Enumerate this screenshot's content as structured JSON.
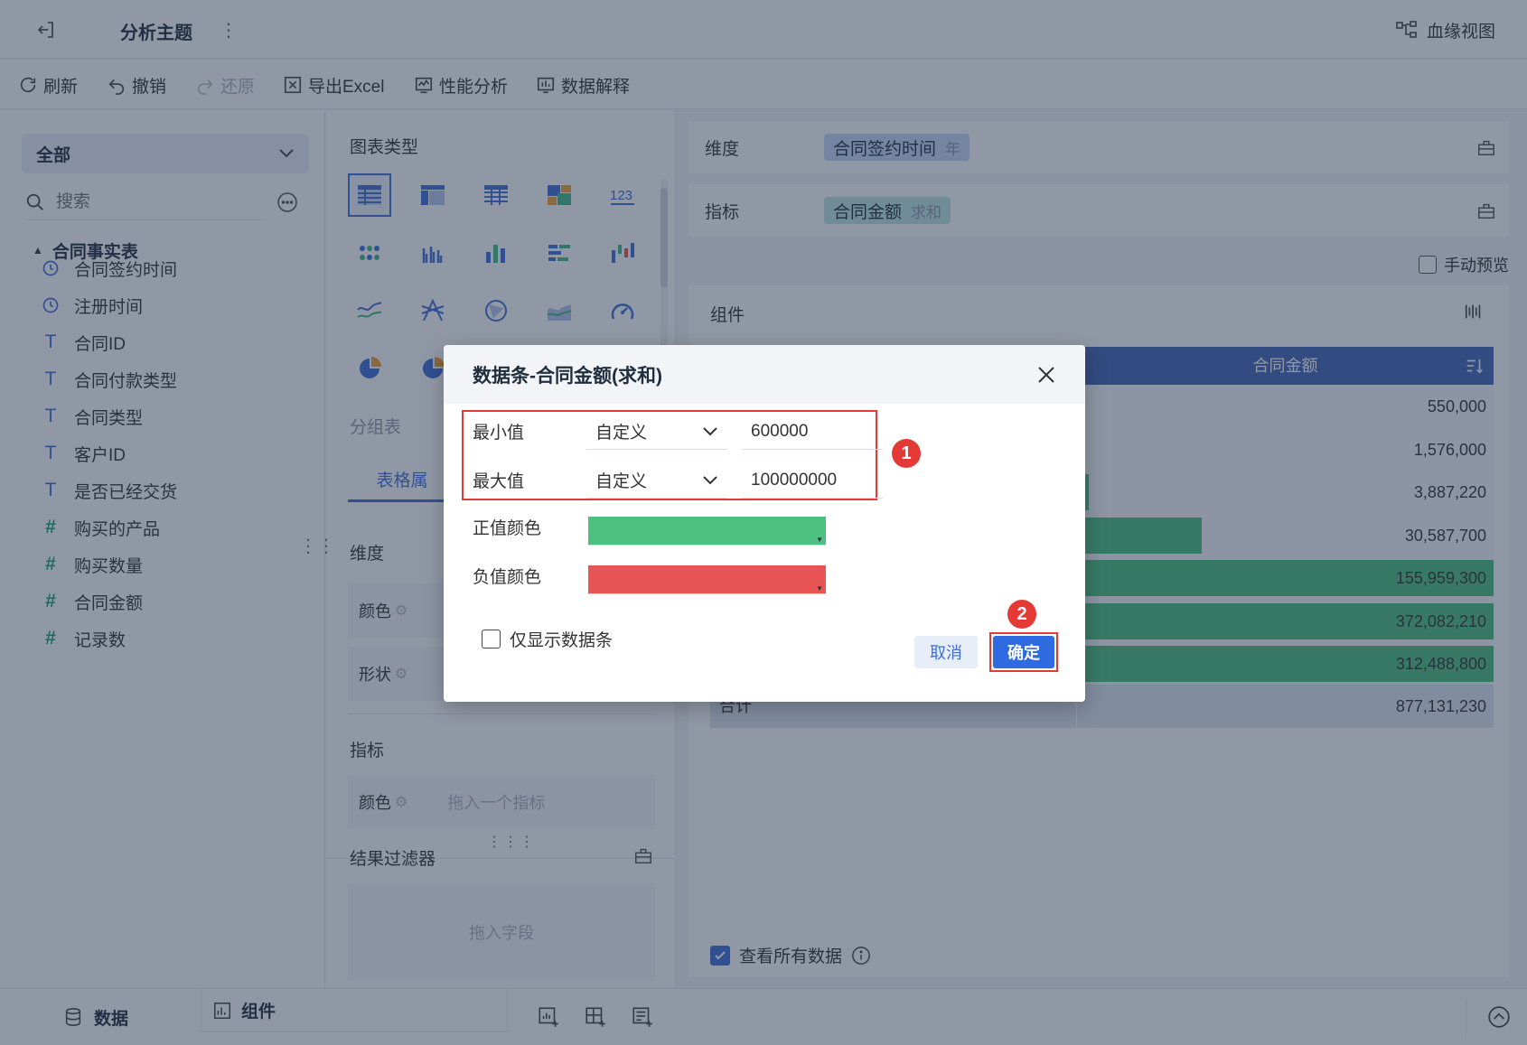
{
  "header": {
    "title": "分析主题",
    "lineage_label": "血缘视图"
  },
  "toolbar": {
    "refresh": "刷新",
    "undo": "撤销",
    "redo": "还原",
    "export": "导出Excel",
    "performance": "性能分析",
    "explain": "数据解释"
  },
  "left": {
    "scope_selected": "全部",
    "search_placeholder": "搜索",
    "table_name": "合同事实表",
    "fields": [
      {
        "name": "合同签约时间",
        "type": "date"
      },
      {
        "name": "注册时间",
        "type": "date"
      },
      {
        "name": "合同ID",
        "type": "text"
      },
      {
        "name": "合同付款类型",
        "type": "text"
      },
      {
        "name": "合同类型",
        "type": "text"
      },
      {
        "name": "客户ID",
        "type": "text"
      },
      {
        "name": "是否已经交货",
        "type": "text"
      },
      {
        "name": "购买的产品",
        "type": "number"
      },
      {
        "name": "购买数量",
        "type": "number"
      },
      {
        "name": "合同金额",
        "type": "number"
      },
      {
        "name": "记录数",
        "type": "number"
      }
    ]
  },
  "middle": {
    "chart_type_title": "图表类型",
    "group_table_label": "分组表",
    "tab_table_props": "表格属",
    "dimension_title": "维度",
    "color_label": "颜色",
    "shape_label": "形状",
    "metric_title": "指标",
    "metric_color_label": "颜色",
    "metric_drop_hint": "拖入一个指标",
    "filter_title": "结果过滤器",
    "filter_drop_hint": "拖入字段"
  },
  "right": {
    "dimension_label": "维度",
    "dimension_field": "合同签约时间",
    "dimension_sub": "年",
    "metric_label": "指标",
    "metric_field": "合同金额",
    "metric_sub": "求和",
    "manual_preview": "手动预览",
    "component_title": "组件",
    "column_header": "合同金额",
    "rows": [
      {
        "value": "550,000",
        "bar": 0
      },
      {
        "value": "1,576,000",
        "bar": 0
      },
      {
        "value": "3,887,220",
        "bar": 0.028
      },
      {
        "value": "30,587,700",
        "bar": 0.3
      },
      {
        "value": "155,959,300",
        "bar": 1.0
      },
      {
        "value": "372,082,210",
        "bar": 1.0
      },
      {
        "value": "312,488,800",
        "bar": 1.0
      }
    ],
    "total_label": "合计",
    "total_value": "877,131,230",
    "view_all": "查看所有数据"
  },
  "bottom": {
    "data_tab": "数据",
    "component_tab": "组件"
  },
  "dialog": {
    "title": "数据条-合同金额(求和)",
    "min_label": "最小值",
    "min_mode": "自定义",
    "min_value": "600000",
    "max_label": "最大值",
    "max_mode": "自定义",
    "max_value": "100000000",
    "pos_color_label": "正值颜色",
    "pos_color": "#4cc07e",
    "neg_color_label": "负值颜色",
    "neg_color": "#e85454",
    "only_bar_label": "仅显示数据条",
    "cancel_label": "取消",
    "confirm_label": "确定",
    "badge1": "1",
    "badge2": "2"
  }
}
